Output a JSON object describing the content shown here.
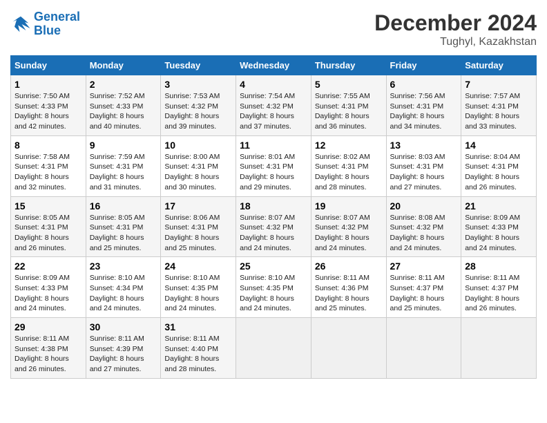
{
  "header": {
    "logo_line1": "General",
    "logo_line2": "Blue",
    "month": "December 2024",
    "location": "Tughyl, Kazakhstan"
  },
  "days_of_week": [
    "Sunday",
    "Monday",
    "Tuesday",
    "Wednesday",
    "Thursday",
    "Friday",
    "Saturday"
  ],
  "weeks": [
    [
      {
        "day": "1",
        "lines": [
          "Sunrise: 7:50 AM",
          "Sunset: 4:33 PM",
          "Daylight: 8 hours",
          "and 42 minutes."
        ]
      },
      {
        "day": "2",
        "lines": [
          "Sunrise: 7:52 AM",
          "Sunset: 4:33 PM",
          "Daylight: 8 hours",
          "and 40 minutes."
        ]
      },
      {
        "day": "3",
        "lines": [
          "Sunrise: 7:53 AM",
          "Sunset: 4:32 PM",
          "Daylight: 8 hours",
          "and 39 minutes."
        ]
      },
      {
        "day": "4",
        "lines": [
          "Sunrise: 7:54 AM",
          "Sunset: 4:32 PM",
          "Daylight: 8 hours",
          "and 37 minutes."
        ]
      },
      {
        "day": "5",
        "lines": [
          "Sunrise: 7:55 AM",
          "Sunset: 4:31 PM",
          "Daylight: 8 hours",
          "and 36 minutes."
        ]
      },
      {
        "day": "6",
        "lines": [
          "Sunrise: 7:56 AM",
          "Sunset: 4:31 PM",
          "Daylight: 8 hours",
          "and 34 minutes."
        ]
      },
      {
        "day": "7",
        "lines": [
          "Sunrise: 7:57 AM",
          "Sunset: 4:31 PM",
          "Daylight: 8 hours",
          "and 33 minutes."
        ]
      }
    ],
    [
      {
        "day": "8",
        "lines": [
          "Sunrise: 7:58 AM",
          "Sunset: 4:31 PM",
          "Daylight: 8 hours",
          "and 32 minutes."
        ]
      },
      {
        "day": "9",
        "lines": [
          "Sunrise: 7:59 AM",
          "Sunset: 4:31 PM",
          "Daylight: 8 hours",
          "and 31 minutes."
        ]
      },
      {
        "day": "10",
        "lines": [
          "Sunrise: 8:00 AM",
          "Sunset: 4:31 PM",
          "Daylight: 8 hours",
          "and 30 minutes."
        ]
      },
      {
        "day": "11",
        "lines": [
          "Sunrise: 8:01 AM",
          "Sunset: 4:31 PM",
          "Daylight: 8 hours",
          "and 29 minutes."
        ]
      },
      {
        "day": "12",
        "lines": [
          "Sunrise: 8:02 AM",
          "Sunset: 4:31 PM",
          "Daylight: 8 hours",
          "and 28 minutes."
        ]
      },
      {
        "day": "13",
        "lines": [
          "Sunrise: 8:03 AM",
          "Sunset: 4:31 PM",
          "Daylight: 8 hours",
          "and 27 minutes."
        ]
      },
      {
        "day": "14",
        "lines": [
          "Sunrise: 8:04 AM",
          "Sunset: 4:31 PM",
          "Daylight: 8 hours",
          "and 26 minutes."
        ]
      }
    ],
    [
      {
        "day": "15",
        "lines": [
          "Sunrise: 8:05 AM",
          "Sunset: 4:31 PM",
          "Daylight: 8 hours",
          "and 26 minutes."
        ]
      },
      {
        "day": "16",
        "lines": [
          "Sunrise: 8:05 AM",
          "Sunset: 4:31 PM",
          "Daylight: 8 hours",
          "and 25 minutes."
        ]
      },
      {
        "day": "17",
        "lines": [
          "Sunrise: 8:06 AM",
          "Sunset: 4:31 PM",
          "Daylight: 8 hours",
          "and 25 minutes."
        ]
      },
      {
        "day": "18",
        "lines": [
          "Sunrise: 8:07 AM",
          "Sunset: 4:32 PM",
          "Daylight: 8 hours",
          "and 24 minutes."
        ]
      },
      {
        "day": "19",
        "lines": [
          "Sunrise: 8:07 AM",
          "Sunset: 4:32 PM",
          "Daylight: 8 hours",
          "and 24 minutes."
        ]
      },
      {
        "day": "20",
        "lines": [
          "Sunrise: 8:08 AM",
          "Sunset: 4:32 PM",
          "Daylight: 8 hours",
          "and 24 minutes."
        ]
      },
      {
        "day": "21",
        "lines": [
          "Sunrise: 8:09 AM",
          "Sunset: 4:33 PM",
          "Daylight: 8 hours",
          "and 24 minutes."
        ]
      }
    ],
    [
      {
        "day": "22",
        "lines": [
          "Sunrise: 8:09 AM",
          "Sunset: 4:33 PM",
          "Daylight: 8 hours",
          "and 24 minutes."
        ]
      },
      {
        "day": "23",
        "lines": [
          "Sunrise: 8:10 AM",
          "Sunset: 4:34 PM",
          "Daylight: 8 hours",
          "and 24 minutes."
        ]
      },
      {
        "day": "24",
        "lines": [
          "Sunrise: 8:10 AM",
          "Sunset: 4:35 PM",
          "Daylight: 8 hours",
          "and 24 minutes."
        ]
      },
      {
        "day": "25",
        "lines": [
          "Sunrise: 8:10 AM",
          "Sunset: 4:35 PM",
          "Daylight: 8 hours",
          "and 24 minutes."
        ]
      },
      {
        "day": "26",
        "lines": [
          "Sunrise: 8:11 AM",
          "Sunset: 4:36 PM",
          "Daylight: 8 hours",
          "and 25 minutes."
        ]
      },
      {
        "day": "27",
        "lines": [
          "Sunrise: 8:11 AM",
          "Sunset: 4:37 PM",
          "Daylight: 8 hours",
          "and 25 minutes."
        ]
      },
      {
        "day": "28",
        "lines": [
          "Sunrise: 8:11 AM",
          "Sunset: 4:37 PM",
          "Daylight: 8 hours",
          "and 26 minutes."
        ]
      }
    ],
    [
      {
        "day": "29",
        "lines": [
          "Sunrise: 8:11 AM",
          "Sunset: 4:38 PM",
          "Daylight: 8 hours",
          "and 26 minutes."
        ]
      },
      {
        "day": "30",
        "lines": [
          "Sunrise: 8:11 AM",
          "Sunset: 4:39 PM",
          "Daylight: 8 hours",
          "and 27 minutes."
        ]
      },
      {
        "day": "31",
        "lines": [
          "Sunrise: 8:11 AM",
          "Sunset: 4:40 PM",
          "Daylight: 8 hours",
          "and 28 minutes."
        ]
      },
      {
        "day": "",
        "lines": []
      },
      {
        "day": "",
        "lines": []
      },
      {
        "day": "",
        "lines": []
      },
      {
        "day": "",
        "lines": []
      }
    ]
  ]
}
